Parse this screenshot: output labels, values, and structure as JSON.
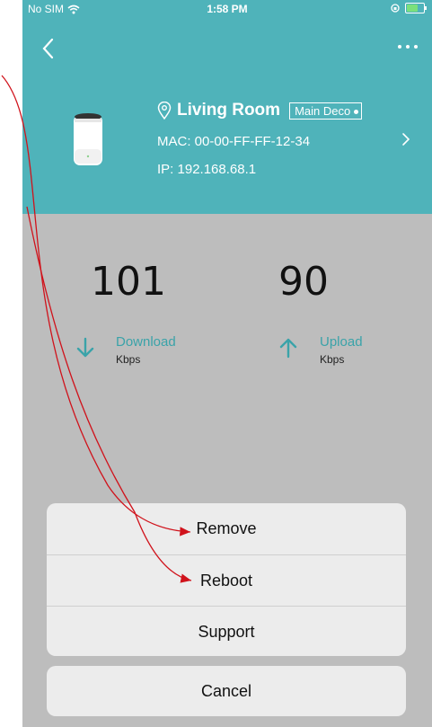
{
  "status_bar": {
    "carrier": "No SIM",
    "time": "1:58 PM",
    "battery_level": 0.7,
    "battery_color": "#7be07b"
  },
  "header": {
    "background_color": "#4fb3ba",
    "location": "Living Room",
    "badge": "Main Deco",
    "mac": "MAC: 00-00-FF-FF-12-34",
    "ip": "IP: 192.168.68.1",
    "back_icon": "chevron-left-icon",
    "more_icon": "more-dots-icon",
    "location_icon": "location-pin-icon",
    "detail_icon": "chevron-right-icon"
  },
  "speeds": {
    "download": {
      "value": "101",
      "label": "Download",
      "unit": "Kbps",
      "icon": "arrow-down-icon"
    },
    "upload": {
      "value": "90",
      "label": "Upload",
      "unit": "Kbps",
      "icon": "arrow-up-icon"
    },
    "accent_color": "#3aa3a9"
  },
  "action_sheet": {
    "items": [
      {
        "label": "Remove"
      },
      {
        "label": "Reboot"
      },
      {
        "label": "Support"
      }
    ],
    "cancel": "Cancel"
  },
  "annotation": {
    "arrow_color": "#d0121b",
    "targets": [
      "Remove",
      "Reboot"
    ]
  }
}
